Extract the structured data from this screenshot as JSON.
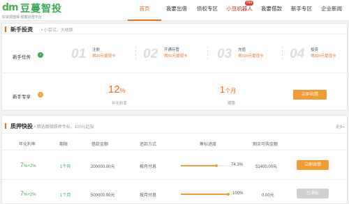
{
  "header": {
    "logo_mark": "dm",
    "logo_name": "豆蔓智投",
    "logo_slogan": "好资源值得·稳健出借平台",
    "nav": [
      {
        "label": "首页",
        "active": true
      },
      {
        "label": "我要出借"
      },
      {
        "label": "债权专区"
      },
      {
        "label": "小豆机器人",
        "badge": "Hot",
        "highlight": true
      },
      {
        "label": "我要借款"
      },
      {
        "label": "新手专区"
      },
      {
        "label": "企业新闻"
      }
    ]
  },
  "newbie": {
    "title": "新手投资",
    "subtitle": "• 小尝试，大收获",
    "tasks_label": "新手任务",
    "tasks": [
      {
        "num": "01",
        "title": "注册",
        "reward": "得20元提现卡"
      },
      {
        "num": "02",
        "title": "开通存管",
        "reward": "得30元提现卡"
      },
      {
        "num": "03",
        "title": "充值",
        "reward": "得100元提现卡"
      },
      {
        "num": "04",
        "title": "投资",
        "reward": "得300元提现卡"
      }
    ],
    "product_label": "新手专享",
    "rate_value": "12",
    "rate_unit": "%",
    "rate_label": "年化利率",
    "term_value": "1",
    "term_unit": "个月",
    "term_label": "期限",
    "button": "立即出借"
  },
  "pledge": {
    "title": "质押快投",
    "subtitle": "• 精选靓號质押专标，100元起投",
    "more": "更多+",
    "columns": [
      "年化利率",
      "期限",
      "借款金额",
      "还款方式",
      "筹标进度",
      "剩余可购金额"
    ],
    "rows": [
      {
        "rate": "7",
        "rate_extra": "%+2%",
        "term": "1个月",
        "amount": "200000.00元",
        "repay": "按月付息",
        "progress": 74.3,
        "progress_label": "74.3%",
        "remaining": "51400.00元",
        "button": "立即出借",
        "button_state": "active"
      },
      {
        "rate": "7",
        "rate_extra": "%+2%",
        "term": "1个月",
        "amount": "500000.00元",
        "repay": "按月付息",
        "progress": 100,
        "progress_label": "100%",
        "remaining": "0.00元",
        "button": "已满标",
        "button_state": "disabled"
      }
    ]
  },
  "colors": {
    "accent": "#e86e1a",
    "green": "#3aa857",
    "button": "#f39c33"
  }
}
